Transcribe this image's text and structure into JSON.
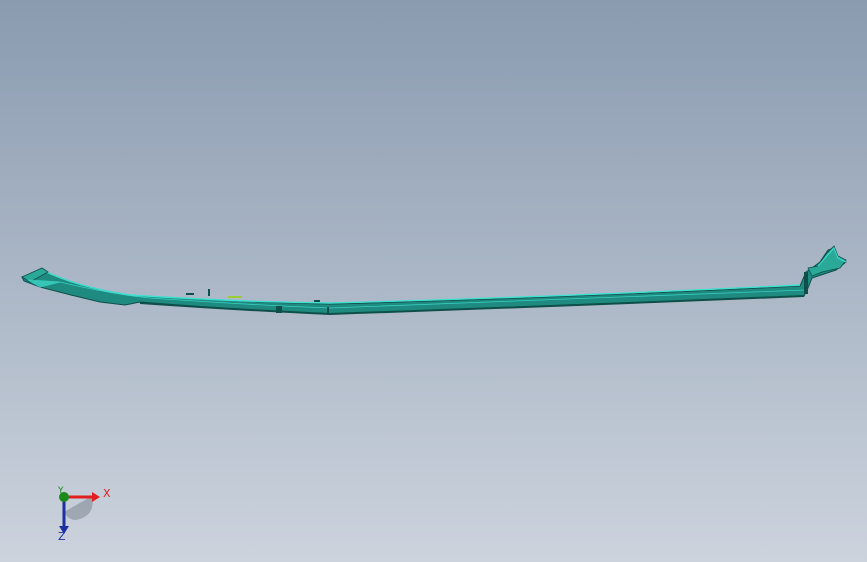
{
  "colors": {
    "background_top": "#8a9bb0",
    "background_bottom": "#ccd3dd",
    "part_body": "#1f8a80",
    "part_dark": "#0f4f4a",
    "part_edge": "#3fe0d0",
    "axis_x": "#e02020",
    "axis_y": "#1a8a1a",
    "axis_z": "#1e2fa0"
  },
  "triad": {
    "x_label": "X",
    "y_label": "Y",
    "z_label": "Z"
  }
}
